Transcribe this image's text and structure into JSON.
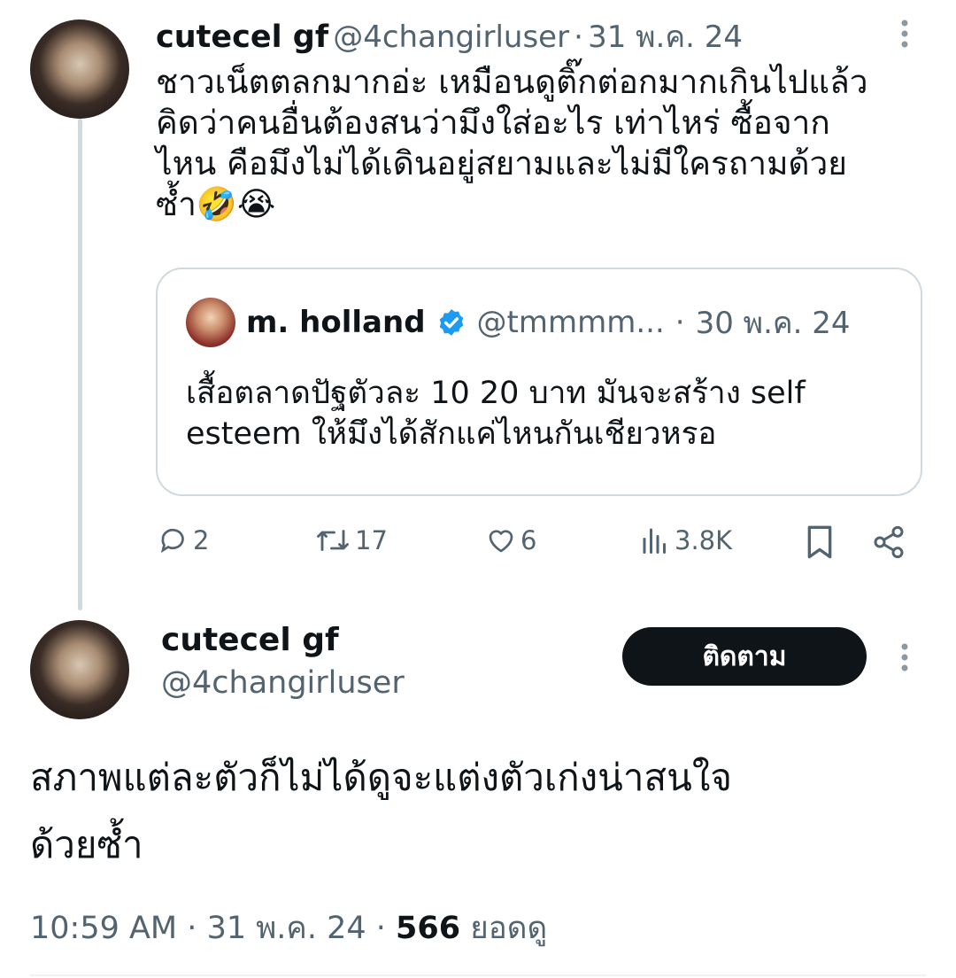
{
  "parent_tweet": {
    "display_name": "cutecel gf",
    "handle": "@4changirluser",
    "separator": "·",
    "date": "31 พ.ค. 24",
    "text_lines": [
      "ชาวเน็ตตลกมากอ่ะ เหมือนดูติ๊กต่อกมากเกินไปแล้ว",
      "คิดว่าคนอื่นต้องสนว่ามึงใส่อะไร เท่าไหร่ ซื้อจาก",
      "ไหน คือมึงไม่ได้เดินอยู่สยามและไม่มีใครถามด้วย",
      "ซ้ำ🤣😭"
    ],
    "quote": {
      "display_name": "m. holland",
      "handle": "@tmmmm...",
      "separator": "·",
      "date": "30 พ.ค. 24",
      "verified": true,
      "text_lines": [
        "เสื้อตลาดปัฐตัวละ 10 20 บาท มันจะสร้าง self",
        "esteem ให้มึงได้สักแค่ไหนกันเชียวหรอ"
      ]
    },
    "actions": {
      "replies": "2",
      "reposts": "17",
      "likes": "6",
      "views": "3.8K"
    }
  },
  "main_tweet": {
    "display_name": "cutecel gf",
    "handle": "@4changirluser",
    "follow_label": "ติดตาม",
    "text_lines": [
      "สภาพแต่ละตัวก็ไม่ได้ดูจะแต่งตัวเก่งน่าสนใจ",
      "ด้วยซ้ำ"
    ],
    "time": "10:59 AM",
    "separator": "·",
    "date": "31 พ.ค. 24",
    "view_count": "566",
    "view_label": "ยอดดู"
  },
  "colors": {
    "text": "#0f1419",
    "muted": "#536471",
    "verified": "#1d9bf0",
    "border": "#cfd9de"
  },
  "icons": [
    "more-icon",
    "reply-icon",
    "repost-icon",
    "like-icon",
    "views-icon",
    "bookmark-icon",
    "share-icon",
    "verified-badge-icon"
  ]
}
